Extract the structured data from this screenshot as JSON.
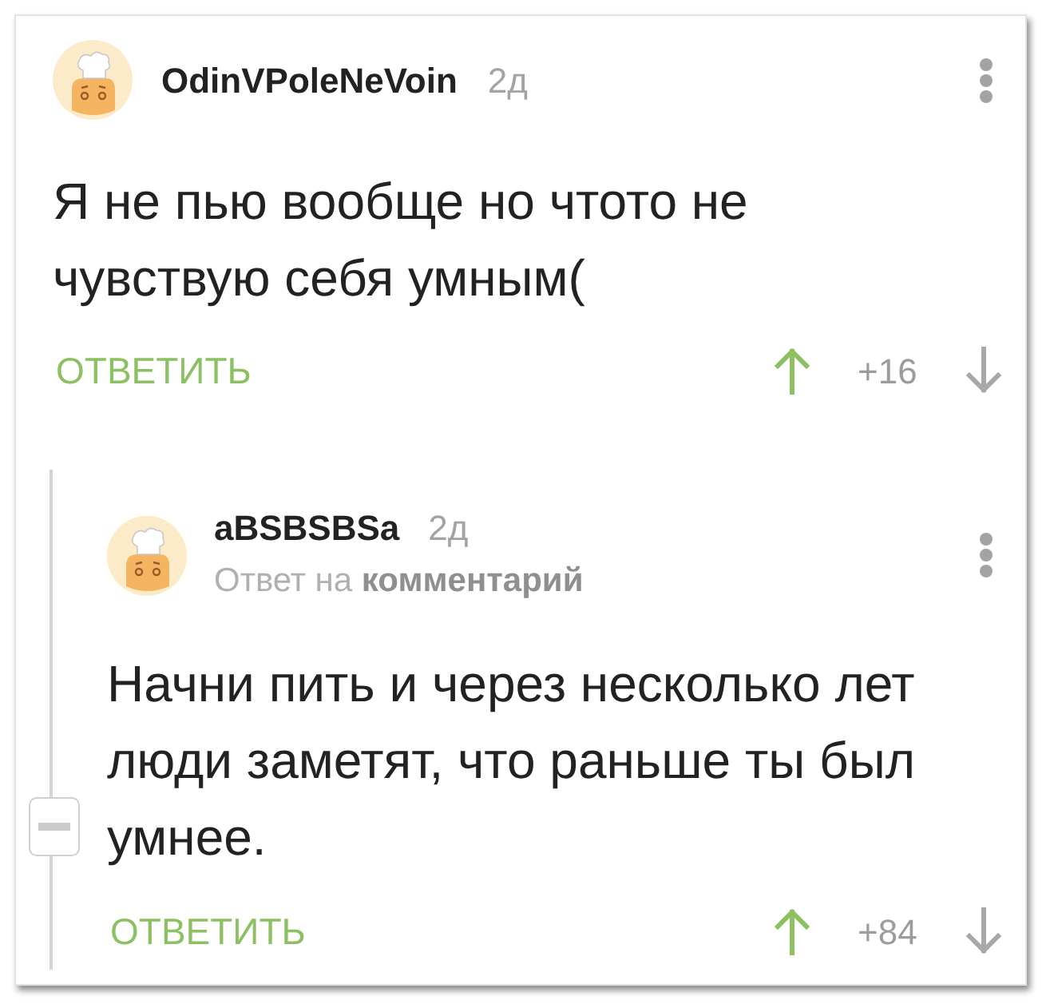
{
  "comments": [
    {
      "author": "OdinVPoleNeVoin",
      "time": "2д",
      "text": "Я не пью вообще но чтото не чувствую себя умным(",
      "reply_action": "ОТВЕТИТЬ",
      "score": "+16",
      "expanded": true,
      "children": [
        {
          "author": "aBSBSBSa",
          "time": "2д",
          "reply_to": "Ответ на **комментарий**",
          "text": "Начни пить и через несколько лет люди заметят, что раньше ты был умнее.",
          "reply_action": "ОТВЕТИТЬ",
          "score": "+84"
        }
      ]
    }
  ]
}
